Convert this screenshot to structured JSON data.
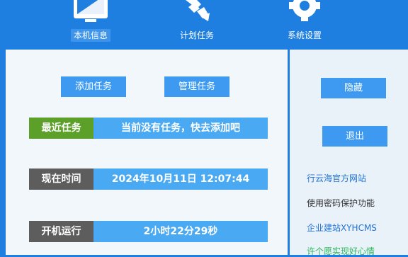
{
  "toolbar": {
    "tabs": [
      {
        "label": "本机信息",
        "icon": "monitor-icon",
        "active": true
      },
      {
        "label": "计划任务",
        "icon": "arrows-icon",
        "active": false
      },
      {
        "label": "系统设置",
        "icon": "gear-icon",
        "active": false
      }
    ]
  },
  "main": {
    "add_task_label": "添加任务",
    "manage_task_label": "管理任务",
    "recent": {
      "label": "最近任务",
      "value": "当前没有任务，快去添加吧"
    },
    "now": {
      "label": "现在时间",
      "value": "2024年10月11日 12:07:44"
    },
    "uptime": {
      "label": "开机运行",
      "value": "2小时22分29秒"
    }
  },
  "side": {
    "hide_label": "隐藏",
    "exit_label": "退出",
    "links": [
      "行云海官方网站",
      "使用密码保护功能",
      "企业建站XYHCMS",
      "许个愿实现好心情"
    ]
  },
  "colors": {
    "background": "#1f7fe0",
    "button": "#3d9af0",
    "recent_tag": "#5ca02a",
    "tag_gray": "#5d5d5d",
    "value_bar": "#49a9f2"
  }
}
